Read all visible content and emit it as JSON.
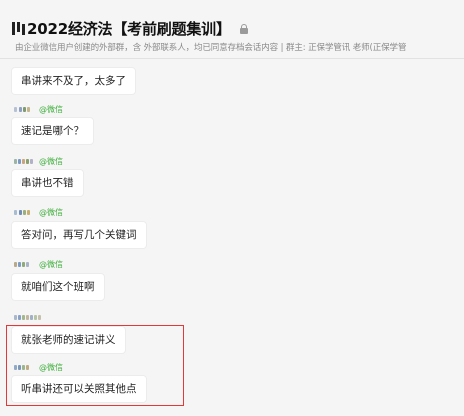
{
  "header": {
    "title": "2022经济法【考前刷题集训】",
    "subtitle": "由企业微信用户创建的外部群，含    外部联系人，均已同意存档会话内容  | 群主: 正保学管讯     老师(正保学管"
  },
  "sender_suffix": "@微信",
  "messages": [
    {
      "text": "串讲来不及了，太多了"
    },
    {
      "text": "速记是哪个？"
    },
    {
      "text": "串讲也不错"
    },
    {
      "text": "答对问，再写几个关键词"
    },
    {
      "text": "就咱们这个班啊"
    },
    {
      "text": "就张老师的速记讲义"
    },
    {
      "text": "听串讲还可以关照其他点"
    }
  ],
  "colors": {
    "highlight_border": "#e23838",
    "wechat_green": "#3fae3c",
    "bubble_bg": "#ffffff",
    "background": "#f5f5f5"
  }
}
